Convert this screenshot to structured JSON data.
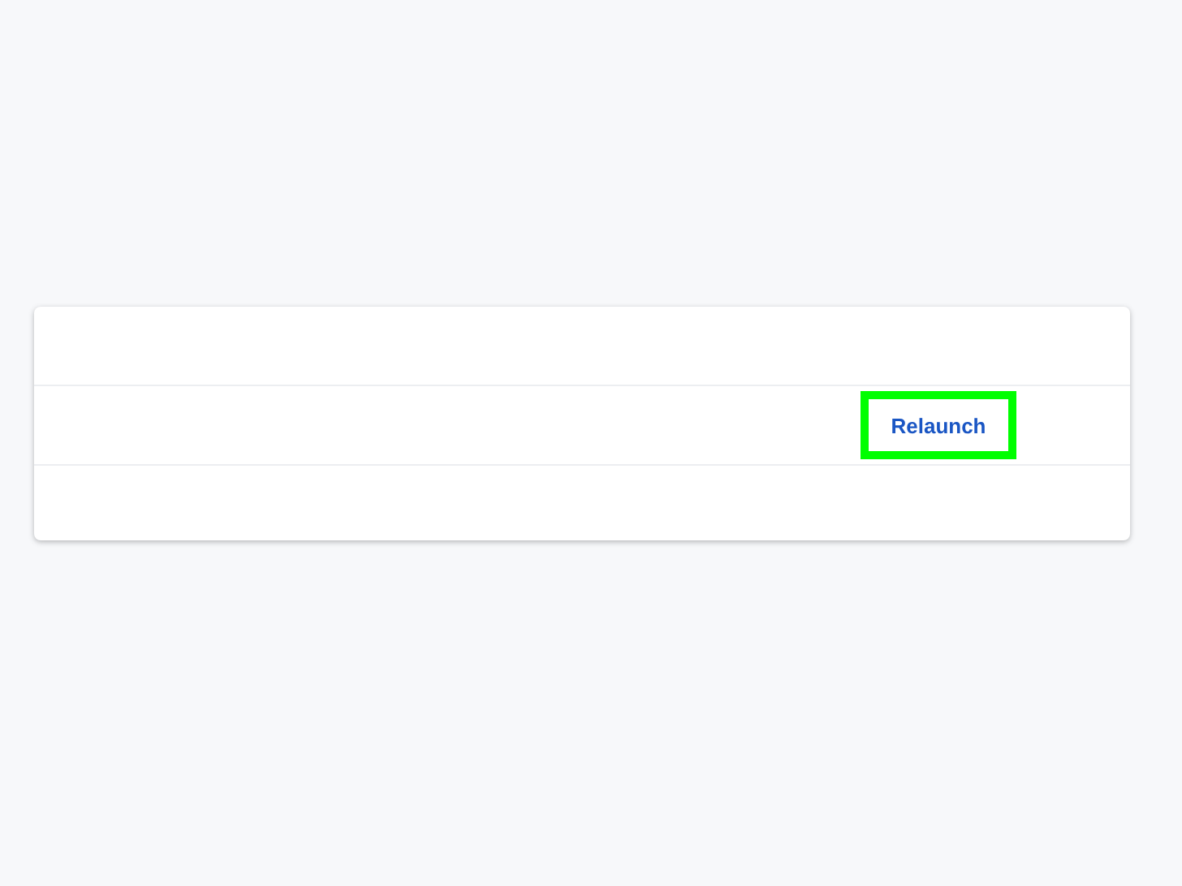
{
  "card": {
    "rows": [
      {
        "kind": "blank"
      },
      {
        "kind": "action",
        "button": {
          "label": "Relaunch",
          "highlighted": true
        }
      },
      {
        "kind": "blank"
      }
    ]
  }
}
